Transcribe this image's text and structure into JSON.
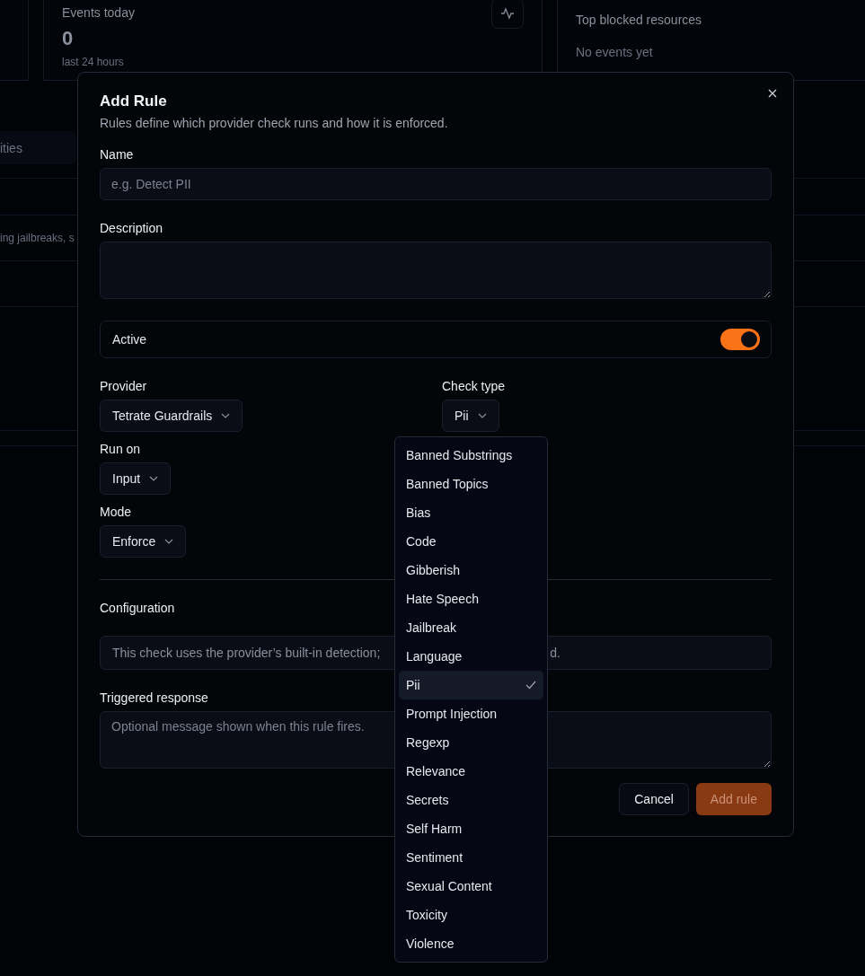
{
  "background": {
    "cards": [
      {
        "title": "Events today",
        "value": "0",
        "caption": "last 24 hours"
      },
      {
        "title": "Top blocked resources",
        "caption": "No events yet"
      }
    ],
    "filter_label": "ities",
    "row_text": "ing jailbreaks, s"
  },
  "dialog": {
    "title": "Add Rule",
    "subtitle": "Rules define which provider check runs and how it is enforced.",
    "fields": [
      {
        "kind": "input",
        "label": "Name",
        "placeholder": "e.g. Detect PII"
      },
      {
        "kind": "textarea",
        "label": "Description"
      }
    ],
    "active": {
      "label": "Active",
      "on": true
    },
    "provider": {
      "label": "Provider",
      "value": "Tetrate Guardrails"
    },
    "check_type": {
      "label": "Check type",
      "value": "Pii"
    },
    "run_on": {
      "label": "Run on",
      "value": "Input"
    },
    "mode": {
      "label": "Mode",
      "value": "Enforce"
    },
    "configuration": {
      "label": "Configuration",
      "text_left": "This check uses the provider’s built-in detection;",
      "text_right": "d."
    },
    "triggered_response": {
      "label": "Triggered response",
      "placeholder": "Optional message shown when this rule fires."
    },
    "buttons": [
      {
        "label": "Cancel",
        "kind": "secondary",
        "disabled": false
      },
      {
        "label": "Add rule",
        "kind": "primary",
        "disabled": true
      }
    ]
  },
  "check_type_menu": {
    "options": [
      {
        "label": "Banned Substrings",
        "selected": false
      },
      {
        "label": "Banned Topics",
        "selected": false
      },
      {
        "label": "Bias",
        "selected": false
      },
      {
        "label": "Code",
        "selected": false
      },
      {
        "label": "Gibberish",
        "selected": false
      },
      {
        "label": "Hate Speech",
        "selected": false
      },
      {
        "label": "Jailbreak",
        "selected": false
      },
      {
        "label": "Language",
        "selected": false
      },
      {
        "label": "Pii",
        "selected": true
      },
      {
        "label": "Prompt Injection",
        "selected": false
      },
      {
        "label": "Regexp",
        "selected": false
      },
      {
        "label": "Relevance",
        "selected": false
      },
      {
        "label": "Secrets",
        "selected": false
      },
      {
        "label": "Self Harm",
        "selected": false
      },
      {
        "label": "Sentiment",
        "selected": false
      },
      {
        "label": "Sexual Content",
        "selected": false
      },
      {
        "label": "Toxicity",
        "selected": false
      },
      {
        "label": "Violence",
        "selected": false
      }
    ]
  }
}
